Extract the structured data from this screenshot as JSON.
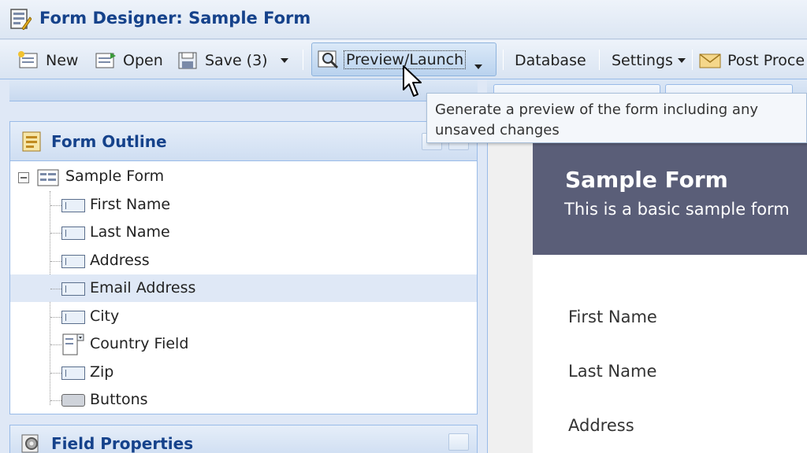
{
  "window": {
    "title": "Form Designer: Sample Form"
  },
  "toolbar": {
    "new_label": "New",
    "open_label": "Open",
    "save_label": "Save (3)",
    "preview_label": "Preview/Launch",
    "database_label": "Database",
    "settings_label": "Settings",
    "post_label": "Post Proce"
  },
  "tooltip": {
    "text": "Generate a preview of the form including any unsaved changes"
  },
  "outline": {
    "title": "Form Outline",
    "root": "Sample Form",
    "items": [
      {
        "label": "First Name",
        "icon": "textfield-icon"
      },
      {
        "label": "Last Name",
        "icon": "textfield-icon"
      },
      {
        "label": "Address",
        "icon": "textfield-icon"
      },
      {
        "label": "Email Address",
        "icon": "textfield-icon"
      },
      {
        "label": "City",
        "icon": "textfield-icon"
      },
      {
        "label": "Country Field",
        "icon": "dropdown-field-icon"
      },
      {
        "label": "Zip",
        "icon": "textfield-icon"
      },
      {
        "label": "Buttons",
        "icon": "button-field-icon"
      }
    ],
    "selected_label": "Email Address"
  },
  "field_properties": {
    "title": "Field Properties"
  },
  "preview": {
    "title": "Sample Form",
    "subtitle": "This is a basic sample form",
    "fields": [
      "First Name",
      "Last Name",
      "Address"
    ]
  },
  "colors": {
    "accent": "#15428b",
    "header": "#5a5e78",
    "selection": "#dfe8f6"
  }
}
